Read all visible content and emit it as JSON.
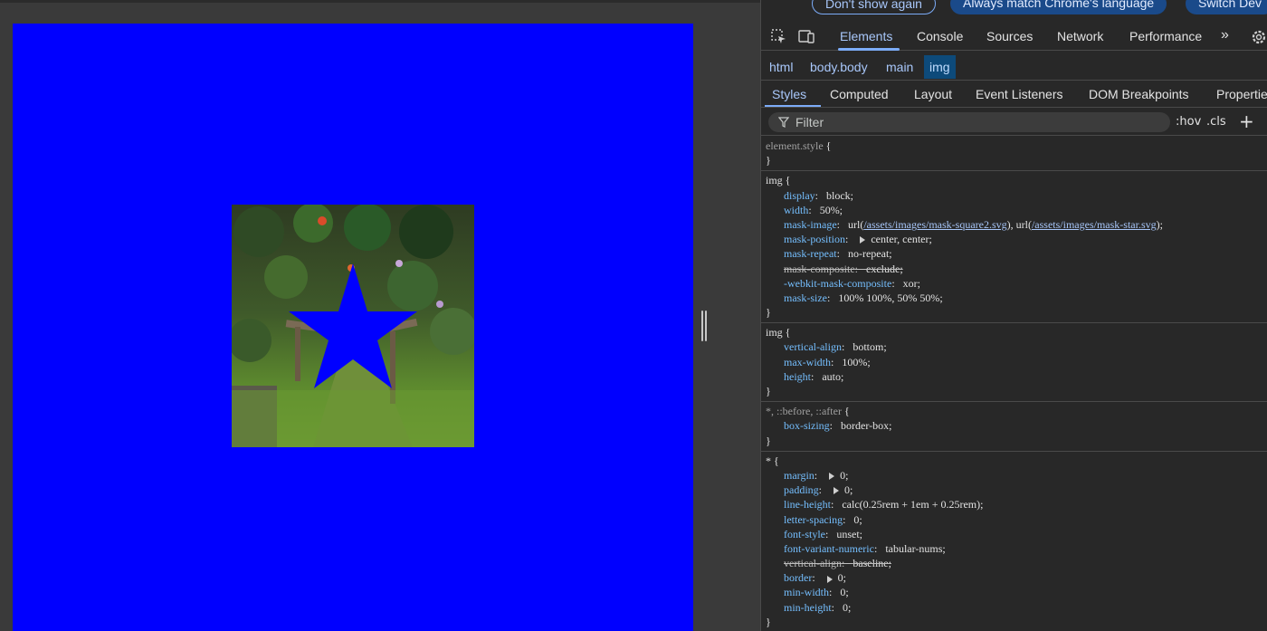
{
  "notice": {
    "dont_show": "Don't show again",
    "match_language": "Always match Chrome's language",
    "switch": "Switch Dev"
  },
  "toolbar": {
    "tabs": [
      "Elements",
      "Console",
      "Sources",
      "Network",
      "Performance"
    ],
    "more": "»"
  },
  "breadcrumbs": [
    "html",
    "body.body",
    "main",
    "img"
  ],
  "subtabs": [
    "Styles",
    "Computed",
    "Layout",
    "Event Listeners",
    "DOM Breakpoints",
    "Properties"
  ],
  "filter": {
    "placeholder": "Filter",
    "hov": ":hov",
    "cls": ".cls",
    "add": "+"
  },
  "rules": [
    {
      "selector": "element.style",
      "declarations": []
    },
    {
      "selector": "img",
      "declarations": [
        {
          "name": "display",
          "value": "block;"
        },
        {
          "name": "width",
          "value": "50%;"
        },
        {
          "name": "mask-image",
          "value_parts": [
            "url(",
            "/assets/images/mask-square2.svg",
            "), url(",
            "/assets/images/mask-star.svg",
            ");"
          ]
        },
        {
          "name": "mask-position",
          "value": "center, center;",
          "expand": true
        },
        {
          "name": "mask-repeat",
          "value": "no-repeat;"
        },
        {
          "name": "mask-composite",
          "value": "exclude;",
          "struck": true
        },
        {
          "name": "-webkit-mask-composite",
          "value": "xor;"
        },
        {
          "name": "mask-size",
          "value": "100% 100%, 50% 50%;"
        }
      ]
    },
    {
      "selector": "img",
      "declarations": [
        {
          "name": "vertical-align",
          "value": "bottom;"
        },
        {
          "name": "max-width",
          "value": "100%;"
        },
        {
          "name": "height",
          "value": "auto;"
        }
      ]
    },
    {
      "selector": "*, ::before, ::after",
      "declarations": [
        {
          "name": "box-sizing",
          "value": "border-box;"
        }
      ]
    },
    {
      "selector": "*",
      "declarations": [
        {
          "name": "margin",
          "value": "0;",
          "expand": true
        },
        {
          "name": "padding",
          "value": "0;",
          "expand": true
        },
        {
          "name": "line-height",
          "value": "calc(0.25rem + 1em + 0.25rem);"
        },
        {
          "name": "letter-spacing",
          "value": "0;"
        },
        {
          "name": "font-style",
          "value": "unset;"
        },
        {
          "name": "font-variant-numeric",
          "value": "tabular-nums;"
        },
        {
          "name": "vertical-align",
          "value": "baseline;",
          "struck": true
        },
        {
          "name": "border",
          "value": "0;",
          "expand": true
        },
        {
          "name": "min-width",
          "value": "0;"
        },
        {
          "name": "min-height",
          "value": "0;"
        }
      ]
    }
  ],
  "colors": {
    "page_background": "#0000ff",
    "devtools_background": "#282828",
    "accent": "#a8c7fa"
  }
}
